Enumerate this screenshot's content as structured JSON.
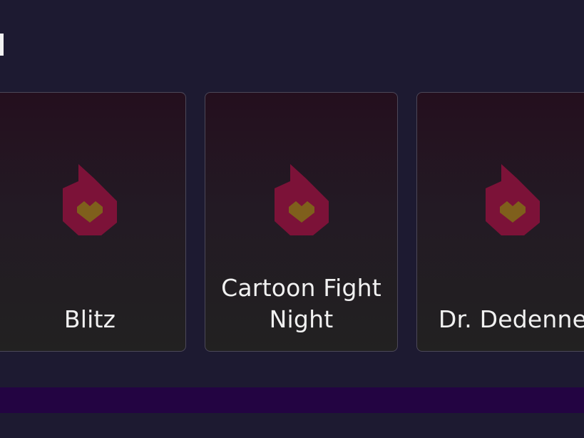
{
  "carousel": {
    "cards": [
      {
        "title": "Blitz",
        "icon": "flame-heart-icon"
      },
      {
        "title": "Cartoon Fight Night",
        "icon": "flame-heart-icon"
      },
      {
        "title": "Dr. Dedenne",
        "icon": "flame-heart-icon"
      }
    ]
  },
  "colors": {
    "background": "#1d1a31",
    "card_border": "#4c4858",
    "flame": "#7c1238",
    "heart": "#7f5f1c",
    "bottom_bar": "#230442",
    "text": "#f1f1f1"
  }
}
